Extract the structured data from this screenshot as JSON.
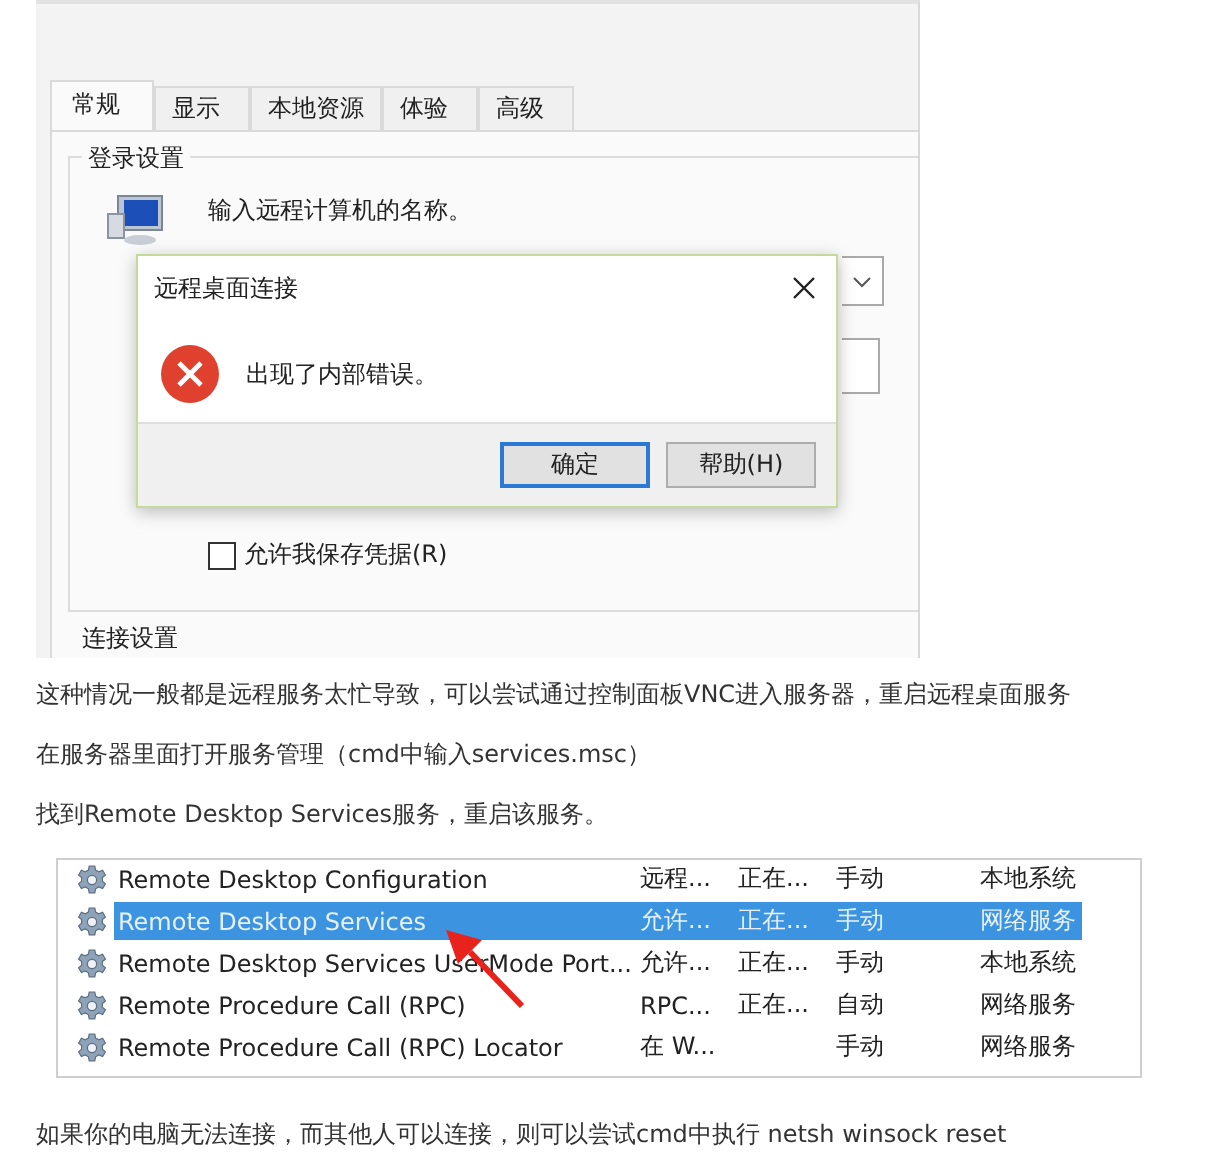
{
  "rdp_window": {
    "tabs": [
      {
        "label": "常规",
        "selected": true
      },
      {
        "label": "显示",
        "selected": false
      },
      {
        "label": "本地资源",
        "selected": false
      },
      {
        "label": "体验",
        "selected": false
      },
      {
        "label": "高级",
        "selected": false
      }
    ],
    "group_title": "登录设置",
    "prompt": "输入远程计算机的名称。",
    "save_credentials": {
      "label": "允许我保存凭据(R)",
      "checked": false
    },
    "next_group_title": "连接设置"
  },
  "error_dialog": {
    "title": "远程桌面连接",
    "message": "出现了内部错误。",
    "buttons": [
      {
        "label": "确定",
        "focused": true
      },
      {
        "label": "帮助(H)",
        "focused": false
      }
    ]
  },
  "intro_paragraphs": [
    "这种情况一般都是远程服务太忙导致，可以尝试通过控制面板VNC进入服务器，重启远程桌面服务",
    "在服务器里面打开服务管理（cmd中输入services.msc）",
    "找到Remote Desktop Services服务，重启该服务。"
  ],
  "services_list": {
    "rows": [
      {
        "name": "Remote Desktop Configuration",
        "description": "远程...",
        "status": "正在...",
        "startup": "手动",
        "logon": "本地系统",
        "selected": false
      },
      {
        "name": "Remote Desktop Services",
        "description": "允许...",
        "status": "正在...",
        "startup": "手动",
        "logon": "网络服务",
        "selected": true
      },
      {
        "name": "Remote Desktop Services UserMode Port...",
        "description": "允许...",
        "status": "正在...",
        "startup": "手动",
        "logon": "本地系统",
        "selected": false
      },
      {
        "name": "Remote Procedure Call (RPC)",
        "description": "RPC...",
        "status": "正在...",
        "startup": "自动",
        "logon": "网络服务",
        "selected": false
      },
      {
        "name": "Remote Procedure Call (RPC) Locator",
        "description": "在 W...",
        "status": "",
        "startup": "手动",
        "logon": "网络服务",
        "selected": false
      }
    ]
  },
  "closing_paragraph": "如果你的电脑无法连接，而其他人可以连接，则可以尝试cmd中执行 netsh winsock reset"
}
